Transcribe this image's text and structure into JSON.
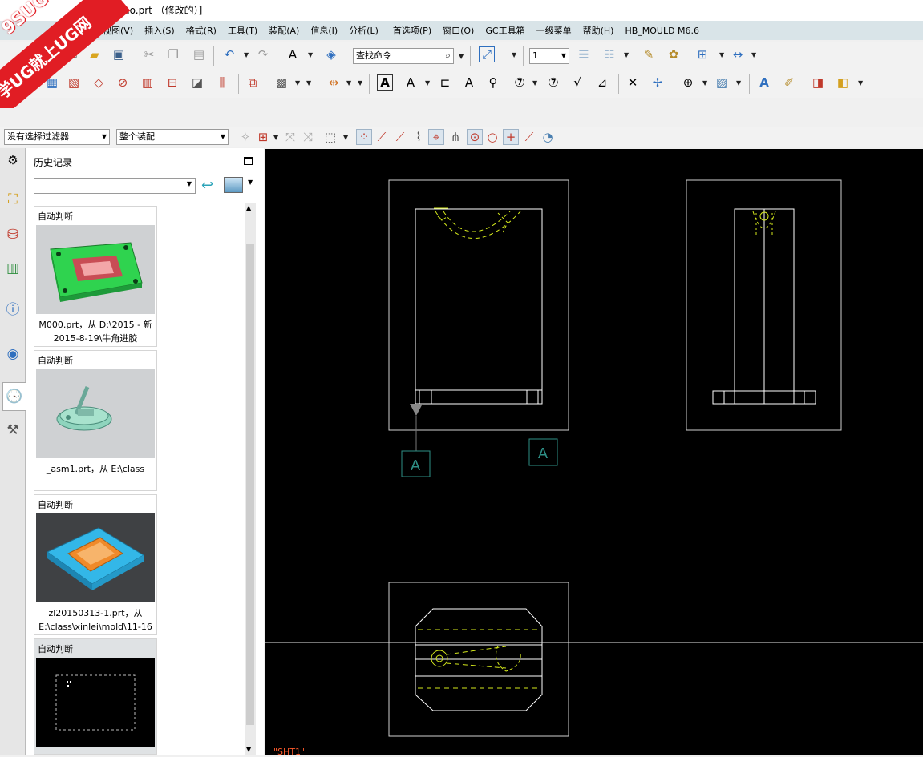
{
  "window": {
    "title": "ujiao.prt （修改的）]"
  },
  "watermark": {
    "top": "9SUG",
    "band": "学UG就上UG网"
  },
  "menu": [
    "视图(V)",
    "插入(S)",
    "格式(R)",
    "工具(T)",
    "装配(A)",
    "信息(I)",
    "分析(L)",
    "首选项(P)",
    "窗口(O)",
    "GC工具箱",
    "一级菜单",
    "帮助(H)",
    "HB_MOULD M6.6"
  ],
  "toolbar": {
    "search_placeholder": "查找命令",
    "layer_value": "1",
    "filter_value": "没有选择过滤器",
    "scope_value": "整个装配"
  },
  "history": {
    "title": "历史记录",
    "items": [
      {
        "header": "自动判断",
        "caption_line1": "M000.prt，从 D:\\2015 - 新",
        "caption_line2": "2015-8-19\\牛角进胶"
      },
      {
        "header": "自动判断",
        "caption_line1": "_asm1.prt，从 E:\\class",
        "caption_line2": ""
      },
      {
        "header": "自动判断",
        "caption_line1": "zl20150313-1.prt，从",
        "caption_line2": "E:\\class\\xinlei\\mold\\11-16"
      },
      {
        "header": "自动判断",
        "caption_line1": "",
        "caption_line2": ""
      }
    ]
  },
  "drawing": {
    "section_label_1": "A",
    "section_label_2": "A",
    "sheet_name": "\"SHT1\"",
    "colors": {
      "line": "#ffffff",
      "hidden": "#d4e81c",
      "label": "#2e8f86",
      "sheet": "#ff5a2a"
    }
  }
}
